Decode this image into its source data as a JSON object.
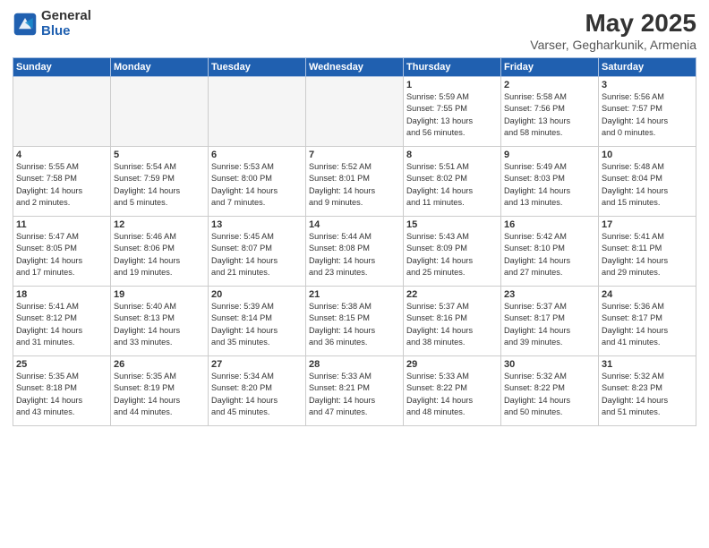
{
  "logo": {
    "general": "General",
    "blue": "Blue"
  },
  "title": "May 2025",
  "subtitle": "Varser, Gegharkunik, Armenia",
  "headers": [
    "Sunday",
    "Monday",
    "Tuesday",
    "Wednesday",
    "Thursday",
    "Friday",
    "Saturday"
  ],
  "weeks": [
    [
      {
        "day": "",
        "info": ""
      },
      {
        "day": "",
        "info": ""
      },
      {
        "day": "",
        "info": ""
      },
      {
        "day": "",
        "info": ""
      },
      {
        "day": "1",
        "info": "Sunrise: 5:59 AM\nSunset: 7:55 PM\nDaylight: 13 hours\nand 56 minutes."
      },
      {
        "day": "2",
        "info": "Sunrise: 5:58 AM\nSunset: 7:56 PM\nDaylight: 13 hours\nand 58 minutes."
      },
      {
        "day": "3",
        "info": "Sunrise: 5:56 AM\nSunset: 7:57 PM\nDaylight: 14 hours\nand 0 minutes."
      }
    ],
    [
      {
        "day": "4",
        "info": "Sunrise: 5:55 AM\nSunset: 7:58 PM\nDaylight: 14 hours\nand 2 minutes."
      },
      {
        "day": "5",
        "info": "Sunrise: 5:54 AM\nSunset: 7:59 PM\nDaylight: 14 hours\nand 5 minutes."
      },
      {
        "day": "6",
        "info": "Sunrise: 5:53 AM\nSunset: 8:00 PM\nDaylight: 14 hours\nand 7 minutes."
      },
      {
        "day": "7",
        "info": "Sunrise: 5:52 AM\nSunset: 8:01 PM\nDaylight: 14 hours\nand 9 minutes."
      },
      {
        "day": "8",
        "info": "Sunrise: 5:51 AM\nSunset: 8:02 PM\nDaylight: 14 hours\nand 11 minutes."
      },
      {
        "day": "9",
        "info": "Sunrise: 5:49 AM\nSunset: 8:03 PM\nDaylight: 14 hours\nand 13 minutes."
      },
      {
        "day": "10",
        "info": "Sunrise: 5:48 AM\nSunset: 8:04 PM\nDaylight: 14 hours\nand 15 minutes."
      }
    ],
    [
      {
        "day": "11",
        "info": "Sunrise: 5:47 AM\nSunset: 8:05 PM\nDaylight: 14 hours\nand 17 minutes."
      },
      {
        "day": "12",
        "info": "Sunrise: 5:46 AM\nSunset: 8:06 PM\nDaylight: 14 hours\nand 19 minutes."
      },
      {
        "day": "13",
        "info": "Sunrise: 5:45 AM\nSunset: 8:07 PM\nDaylight: 14 hours\nand 21 minutes."
      },
      {
        "day": "14",
        "info": "Sunrise: 5:44 AM\nSunset: 8:08 PM\nDaylight: 14 hours\nand 23 minutes."
      },
      {
        "day": "15",
        "info": "Sunrise: 5:43 AM\nSunset: 8:09 PM\nDaylight: 14 hours\nand 25 minutes."
      },
      {
        "day": "16",
        "info": "Sunrise: 5:42 AM\nSunset: 8:10 PM\nDaylight: 14 hours\nand 27 minutes."
      },
      {
        "day": "17",
        "info": "Sunrise: 5:41 AM\nSunset: 8:11 PM\nDaylight: 14 hours\nand 29 minutes."
      }
    ],
    [
      {
        "day": "18",
        "info": "Sunrise: 5:41 AM\nSunset: 8:12 PM\nDaylight: 14 hours\nand 31 minutes."
      },
      {
        "day": "19",
        "info": "Sunrise: 5:40 AM\nSunset: 8:13 PM\nDaylight: 14 hours\nand 33 minutes."
      },
      {
        "day": "20",
        "info": "Sunrise: 5:39 AM\nSunset: 8:14 PM\nDaylight: 14 hours\nand 35 minutes."
      },
      {
        "day": "21",
        "info": "Sunrise: 5:38 AM\nSunset: 8:15 PM\nDaylight: 14 hours\nand 36 minutes."
      },
      {
        "day": "22",
        "info": "Sunrise: 5:37 AM\nSunset: 8:16 PM\nDaylight: 14 hours\nand 38 minutes."
      },
      {
        "day": "23",
        "info": "Sunrise: 5:37 AM\nSunset: 8:17 PM\nDaylight: 14 hours\nand 39 minutes."
      },
      {
        "day": "24",
        "info": "Sunrise: 5:36 AM\nSunset: 8:17 PM\nDaylight: 14 hours\nand 41 minutes."
      }
    ],
    [
      {
        "day": "25",
        "info": "Sunrise: 5:35 AM\nSunset: 8:18 PM\nDaylight: 14 hours\nand 43 minutes."
      },
      {
        "day": "26",
        "info": "Sunrise: 5:35 AM\nSunset: 8:19 PM\nDaylight: 14 hours\nand 44 minutes."
      },
      {
        "day": "27",
        "info": "Sunrise: 5:34 AM\nSunset: 8:20 PM\nDaylight: 14 hours\nand 45 minutes."
      },
      {
        "day": "28",
        "info": "Sunrise: 5:33 AM\nSunset: 8:21 PM\nDaylight: 14 hours\nand 47 minutes."
      },
      {
        "day": "29",
        "info": "Sunrise: 5:33 AM\nSunset: 8:22 PM\nDaylight: 14 hours\nand 48 minutes."
      },
      {
        "day": "30",
        "info": "Sunrise: 5:32 AM\nSunset: 8:22 PM\nDaylight: 14 hours\nand 50 minutes."
      },
      {
        "day": "31",
        "info": "Sunrise: 5:32 AM\nSunset: 8:23 PM\nDaylight: 14 hours\nand 51 minutes."
      }
    ]
  ]
}
